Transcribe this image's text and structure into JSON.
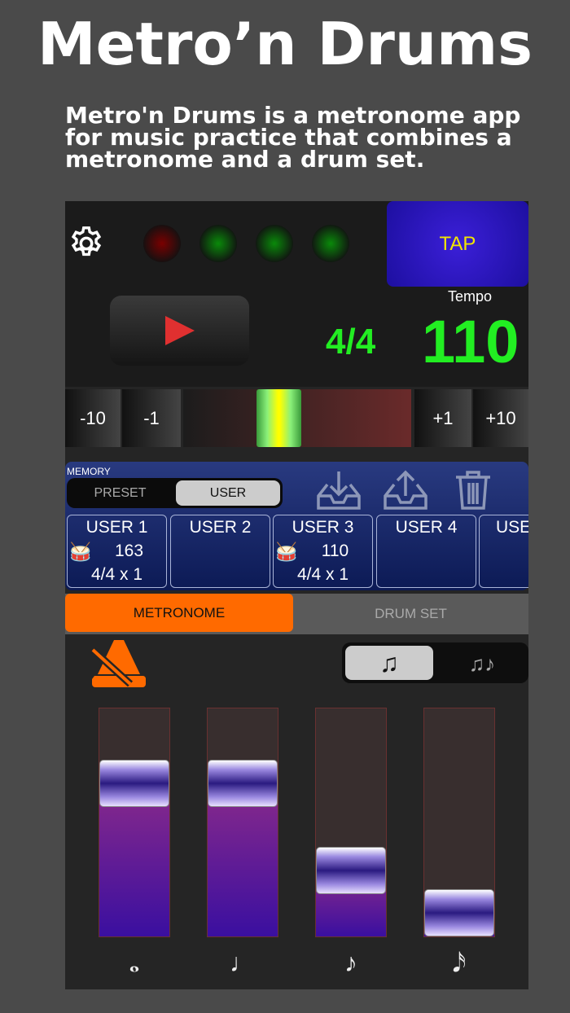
{
  "title": "Metro’n Drums",
  "description": "Metro'n Drums is a metronome app for music practice that combines a metronome and a drum set.",
  "app": {
    "leds": [
      "#7a0000",
      "#0a8a0a",
      "#0a8a0a",
      "#0a8a0a"
    ],
    "tap_label": "TAP",
    "tempo_label": "Tempo",
    "time_signature": "4/4",
    "tempo": "110",
    "tempo_buttons": [
      "-10",
      "-1",
      "+1",
      "+10"
    ],
    "tempo_slider_position": 0.4,
    "memory": {
      "label": "MEMORY",
      "tabs": [
        "PRESET",
        "USER"
      ],
      "selected_tab": "USER",
      "slots": [
        {
          "name": "USER 1",
          "tempo": "163",
          "meter": "4/4 x 1",
          "drum": true
        },
        {
          "name": "USER 2",
          "tempo": "",
          "meter": "",
          "drum": false
        },
        {
          "name": "USER 3",
          "tempo": "110",
          "meter": "4/4 x 1",
          "drum": true
        },
        {
          "name": "USER 4",
          "tempo": "",
          "meter": "",
          "drum": false
        },
        {
          "name": "USE",
          "tempo": "",
          "meter": "",
          "drum": false
        }
      ]
    },
    "modes": [
      "METRONOME",
      "DRUM SET"
    ],
    "selected_mode": "METRONOME",
    "note_modes": [
      "♫",
      "triplets"
    ],
    "faders": [
      {
        "label": "𝅝",
        "level": 0.67
      },
      {
        "label": "♩",
        "level": 0.67
      },
      {
        "label": "♪",
        "level": 0.29
      },
      {
        "label": "𝅘𝅥𝅯",
        "level": 0.09
      }
    ]
  }
}
